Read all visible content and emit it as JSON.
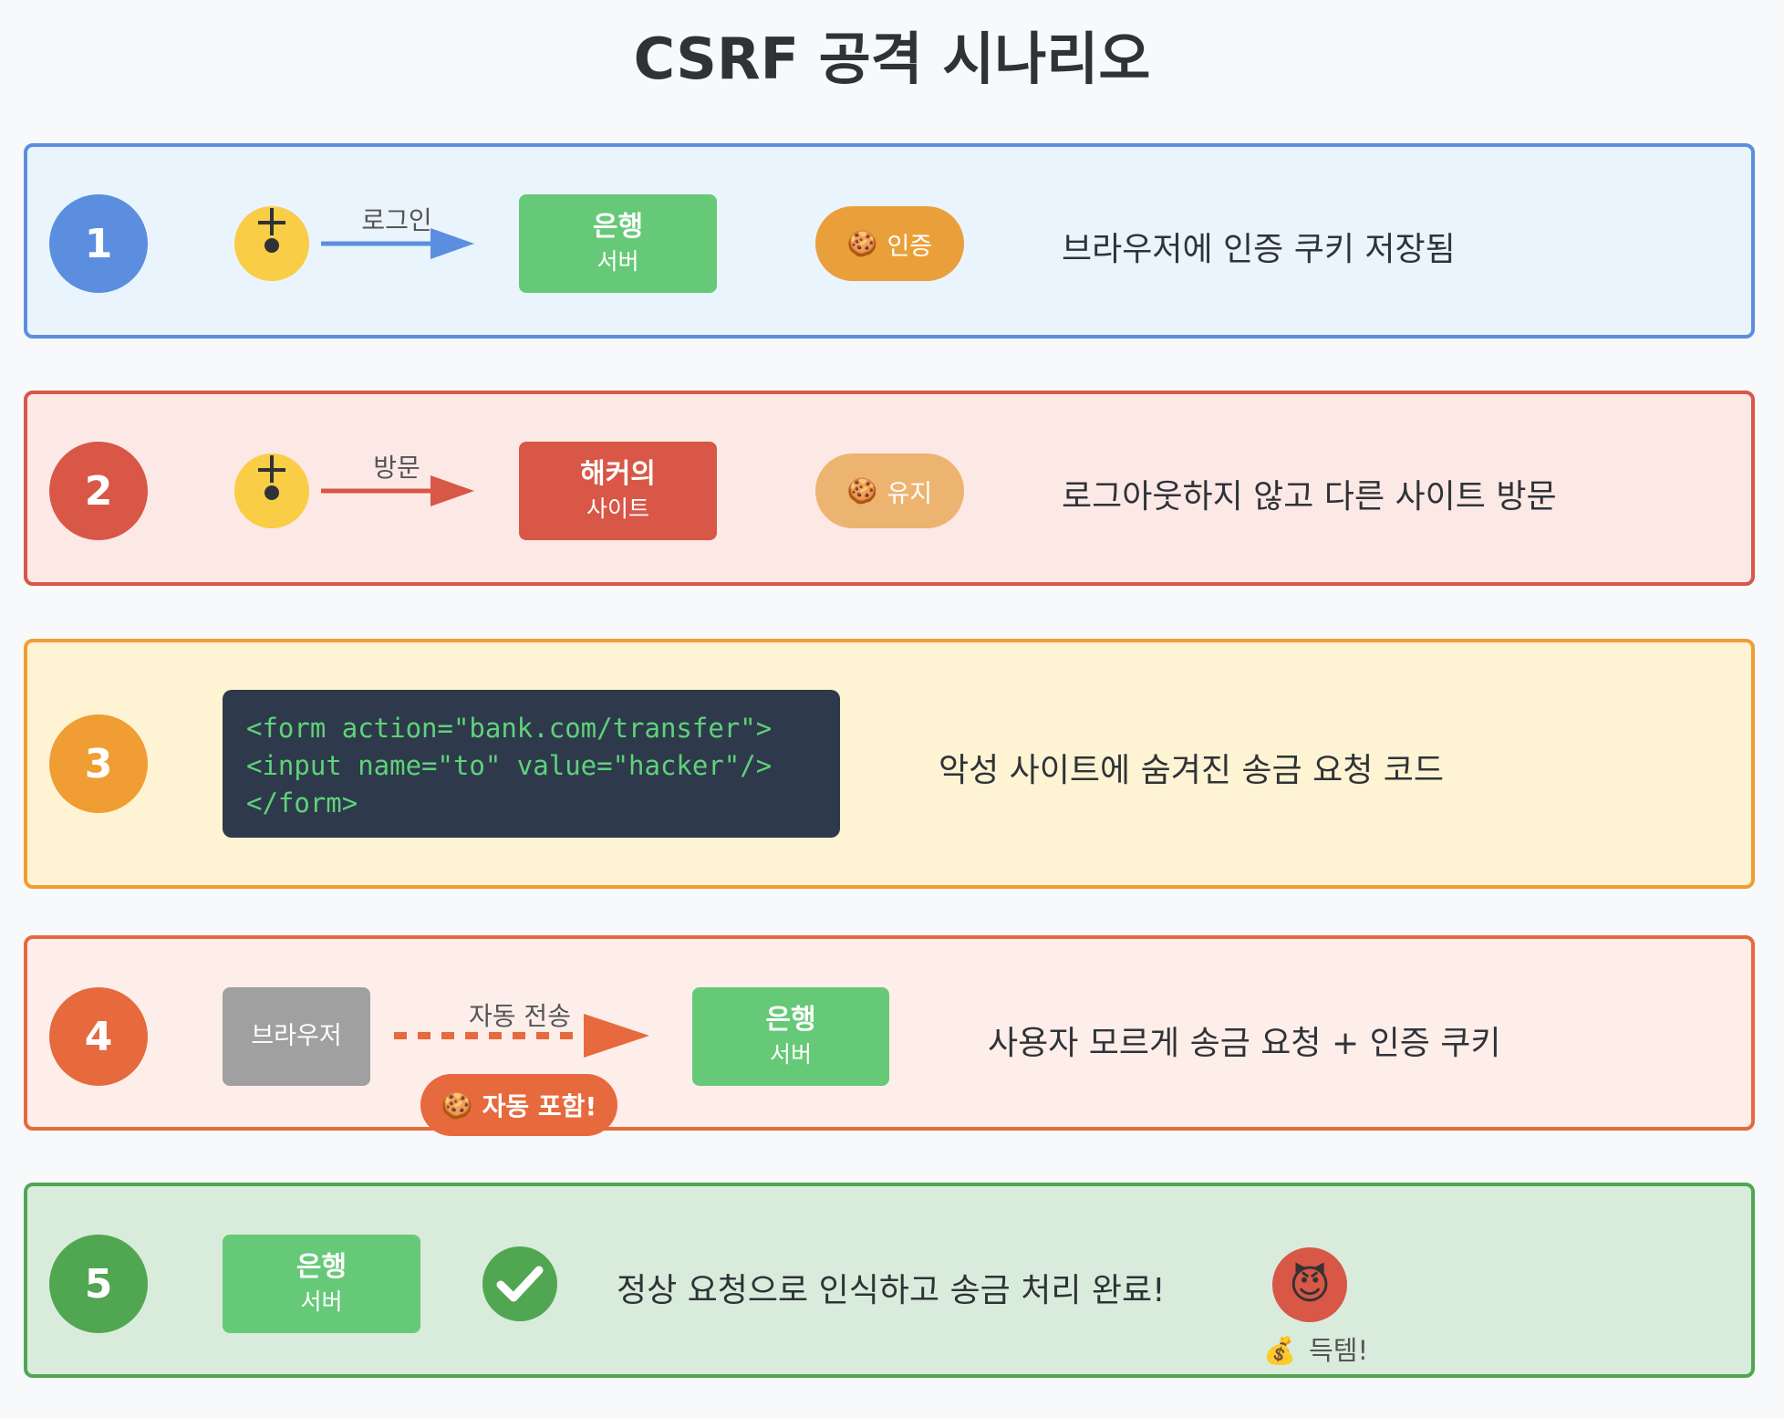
{
  "title": "CSRF 공격 시나리오",
  "steps": [
    {
      "number": "1",
      "arrow_label": "로그인",
      "box_main": "은행",
      "box_sub": "서버",
      "pill_icon": "🍪",
      "pill_text": "인증",
      "description": "브라우저에 인증 쿠키 저장됨"
    },
    {
      "number": "2",
      "arrow_label": "방문",
      "box_main": "해커의",
      "box_sub": "사이트",
      "pill_icon": "🍪",
      "pill_text": "유지",
      "description": "로그아웃하지 않고 다른 사이트 방문"
    },
    {
      "number": "3",
      "code_lines": [
        "<form action=\"bank.com/transfer\">",
        "<input name=\"to\" value=\"hacker\"/>",
        "</form>"
      ],
      "description": "악성 사이트에 숨겨진 송금 요청 코드"
    },
    {
      "number": "4",
      "source_box": "브라우저",
      "arrow_label": "자동 전송",
      "box_main": "은행",
      "box_sub": "서버",
      "pill_icon": "🍪",
      "pill_text": "자동 포함!",
      "description": "사용자 모르게 송금 요청 + 인증 쿠키"
    },
    {
      "number": "5",
      "box_main": "은행",
      "box_sub": "서버",
      "description": "정상 요청으로 인식하고 송금 처리 완료!",
      "devil_icon": "😈",
      "loot_icon": "💰",
      "loot_text": "득템!"
    }
  ],
  "colors": {
    "step1": "#5b8ede",
    "step2": "#d85747",
    "step3": "#f09d34",
    "step4": "#e66a3d",
    "step5": "#51a652",
    "bank": "#66c978",
    "hacker": "#d85747",
    "browser": "#a0a0a0",
    "code_bg": "#2e3a4b",
    "code_text": "#5fd27a"
  }
}
